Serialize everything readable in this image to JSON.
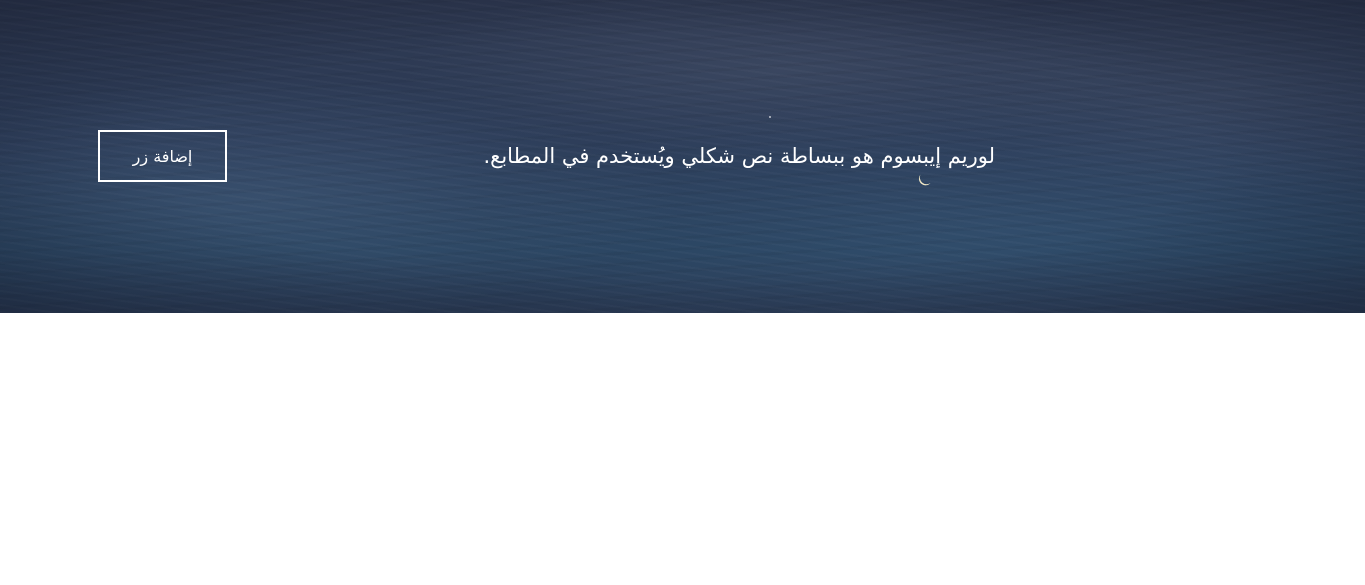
{
  "hero": {
    "headline": "لوريم إيبسوم هو ببساطة نص شكلي ويُستخدم في المطابع.",
    "button_label": "إضافة زر",
    "background_colors": {
      "top": "#2e3850",
      "middle": "#2c3c58",
      "bottom": "#29435f"
    },
    "moon_icon": "crescent-moon-icon",
    "moon_color": "#efe6c4"
  },
  "content": {
    "background": "#ffffff"
  }
}
